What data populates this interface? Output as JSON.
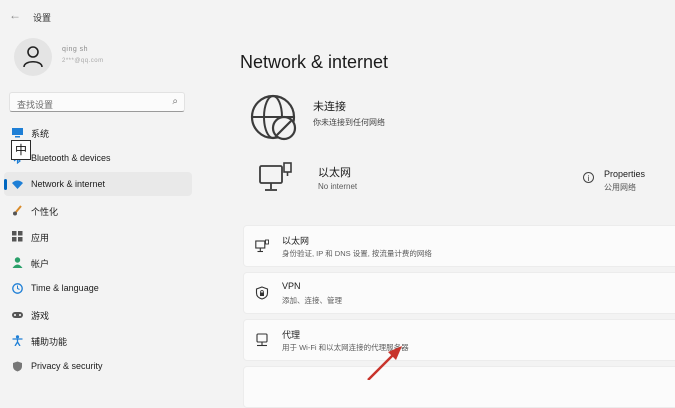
{
  "window": {
    "title": "设置"
  },
  "user": {
    "name": "qing sh",
    "email": "2***@qq.com"
  },
  "search": {
    "placeholder": "查找设置"
  },
  "ime": {
    "indicator": "中"
  },
  "sidebar": {
    "items": [
      {
        "label": "系统",
        "icon": "system-icon",
        "color": "#1e7fd6"
      },
      {
        "label": "Bluetooth & devices",
        "icon": "bluetooth-icon",
        "color": "#1e7fd6"
      },
      {
        "label": "Network & internet",
        "icon": "wifi-icon",
        "color": "#1e7fd6",
        "selected": true
      },
      {
        "label": "个性化",
        "icon": "brush-icon",
        "color": "#d98b2a"
      },
      {
        "label": "应用",
        "icon": "apps-icon",
        "color": "#555555"
      },
      {
        "label": "帐户",
        "icon": "account-icon",
        "color": "#2aa06a"
      },
      {
        "label": "Time & language",
        "icon": "globe-clock-icon",
        "color": "#1e7fd6"
      },
      {
        "label": "游戏",
        "icon": "gaming-icon",
        "color": "#555555"
      },
      {
        "label": "辅助功能",
        "icon": "accessibility-icon",
        "color": "#1e7fd6"
      },
      {
        "label": "Privacy & security",
        "icon": "shield-icon",
        "color": "#666666"
      }
    ]
  },
  "main": {
    "title": "Network & internet",
    "status": {
      "title": "未连接",
      "subtitle": "你未连接到任何网络"
    },
    "ethernet": {
      "name": "以太网",
      "status": "No internet",
      "properties_title": "Properties",
      "properties_sub": "公用网络"
    },
    "cards": [
      {
        "title": "以太网",
        "desc": "身份验证, IP 和 DNS 设置, 按流量计费的网络",
        "icon": "ethernet-icon"
      },
      {
        "title": "VPN",
        "desc": "添加、连接、管理",
        "icon": "vpn-shield-icon"
      },
      {
        "title": "代理",
        "desc": "用于 Wi-Fi 和以太网连接的代理服务器",
        "icon": "proxy-icon"
      }
    ]
  },
  "accent_color": "#0067c0",
  "annotation_color": "#c8332b"
}
